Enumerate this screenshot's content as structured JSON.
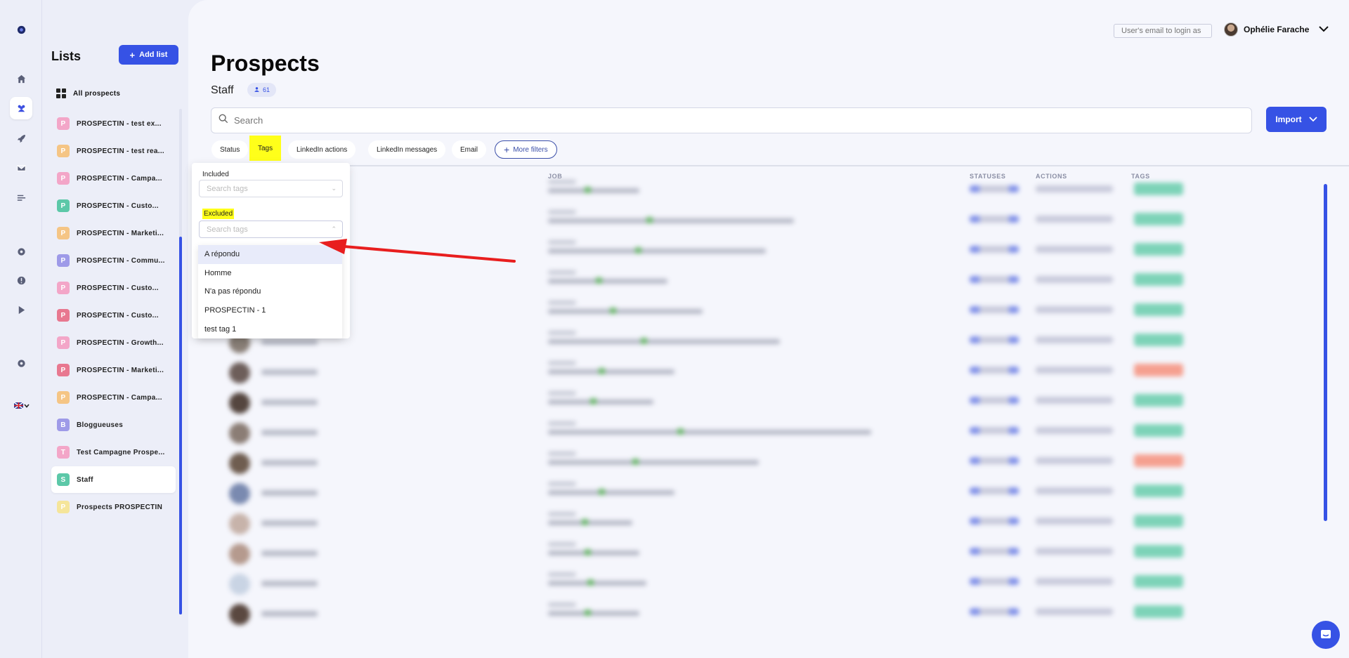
{
  "sidebar": {
    "lists_title": "Lists",
    "add_list_label": "Add list",
    "all_prospects_label": "All prospects",
    "items": [
      {
        "badge": "P",
        "label": "PROSPECTIN - test ex...",
        "color": "#f3a6c8"
      },
      {
        "badge": "P",
        "label": "PROSPECTIN - test rea...",
        "color": "#f5c585"
      },
      {
        "badge": "P",
        "label": "PROSPECTIN - Campa...",
        "color": "#f3a6c8"
      },
      {
        "badge": "P",
        "label": "PROSPECTIN - Custo...",
        "color": "#5cc8a8"
      },
      {
        "badge": "P",
        "label": "PROSPECTIN - Marketi...",
        "color": "#f5c585"
      },
      {
        "badge": "P",
        "label": "PROSPECTIN - Commu...",
        "color": "#9e9ae8"
      },
      {
        "badge": "P",
        "label": "PROSPECTIN - Custo...",
        "color": "#f3a6c8"
      },
      {
        "badge": "P",
        "label": "PROSPECTIN - Custo...",
        "color": "#e87890"
      },
      {
        "badge": "P",
        "label": "PROSPECTIN - Growth...",
        "color": "#f3a6c8"
      },
      {
        "badge": "P",
        "label": "PROSPECTIN - Marketi...",
        "color": "#e87890"
      },
      {
        "badge": "P",
        "label": "PROSPECTIN - Campa...",
        "color": "#f5c585"
      },
      {
        "badge": "B",
        "label": "Bloggueuses",
        "color": "#9e9ae8"
      },
      {
        "badge": "T",
        "label": "Test Campagne Prospe...",
        "color": "#f3a6c8"
      },
      {
        "badge": "S",
        "label": "Staff",
        "color": "#5cc8a8",
        "active": true
      },
      {
        "badge": "P",
        "label": "Prospects PROSPECTIN",
        "color": "#f5e59a"
      }
    ]
  },
  "header": {
    "login_as_placeholder": "User's email to login as",
    "user_name": "Ophélie Farache"
  },
  "main": {
    "title": "Prospects",
    "list_name": "Staff",
    "count": "61",
    "search_placeholder": "Search",
    "import_label": "Import",
    "filters": [
      "Status",
      "Tags",
      "LinkedIn actions",
      "LinkedIn messages",
      "Email"
    ],
    "more_filters_label": "More filters",
    "columns": {
      "job": "JOB",
      "statuses": "STATUSES",
      "actions": "ACTIONS",
      "tags": "TAGS"
    }
  },
  "tags_dropdown": {
    "included_label": "Included",
    "excluded_label": "Excluded",
    "search_placeholder": "Search tags",
    "options": [
      "A répondu",
      "Homme",
      "N'a pas répondu",
      "PROSPECTIN - 1",
      "test tag 1"
    ]
  },
  "colors": {
    "accent": "#3652e5",
    "highlight": "#ffff1a",
    "arrow": "#e81e1e"
  }
}
